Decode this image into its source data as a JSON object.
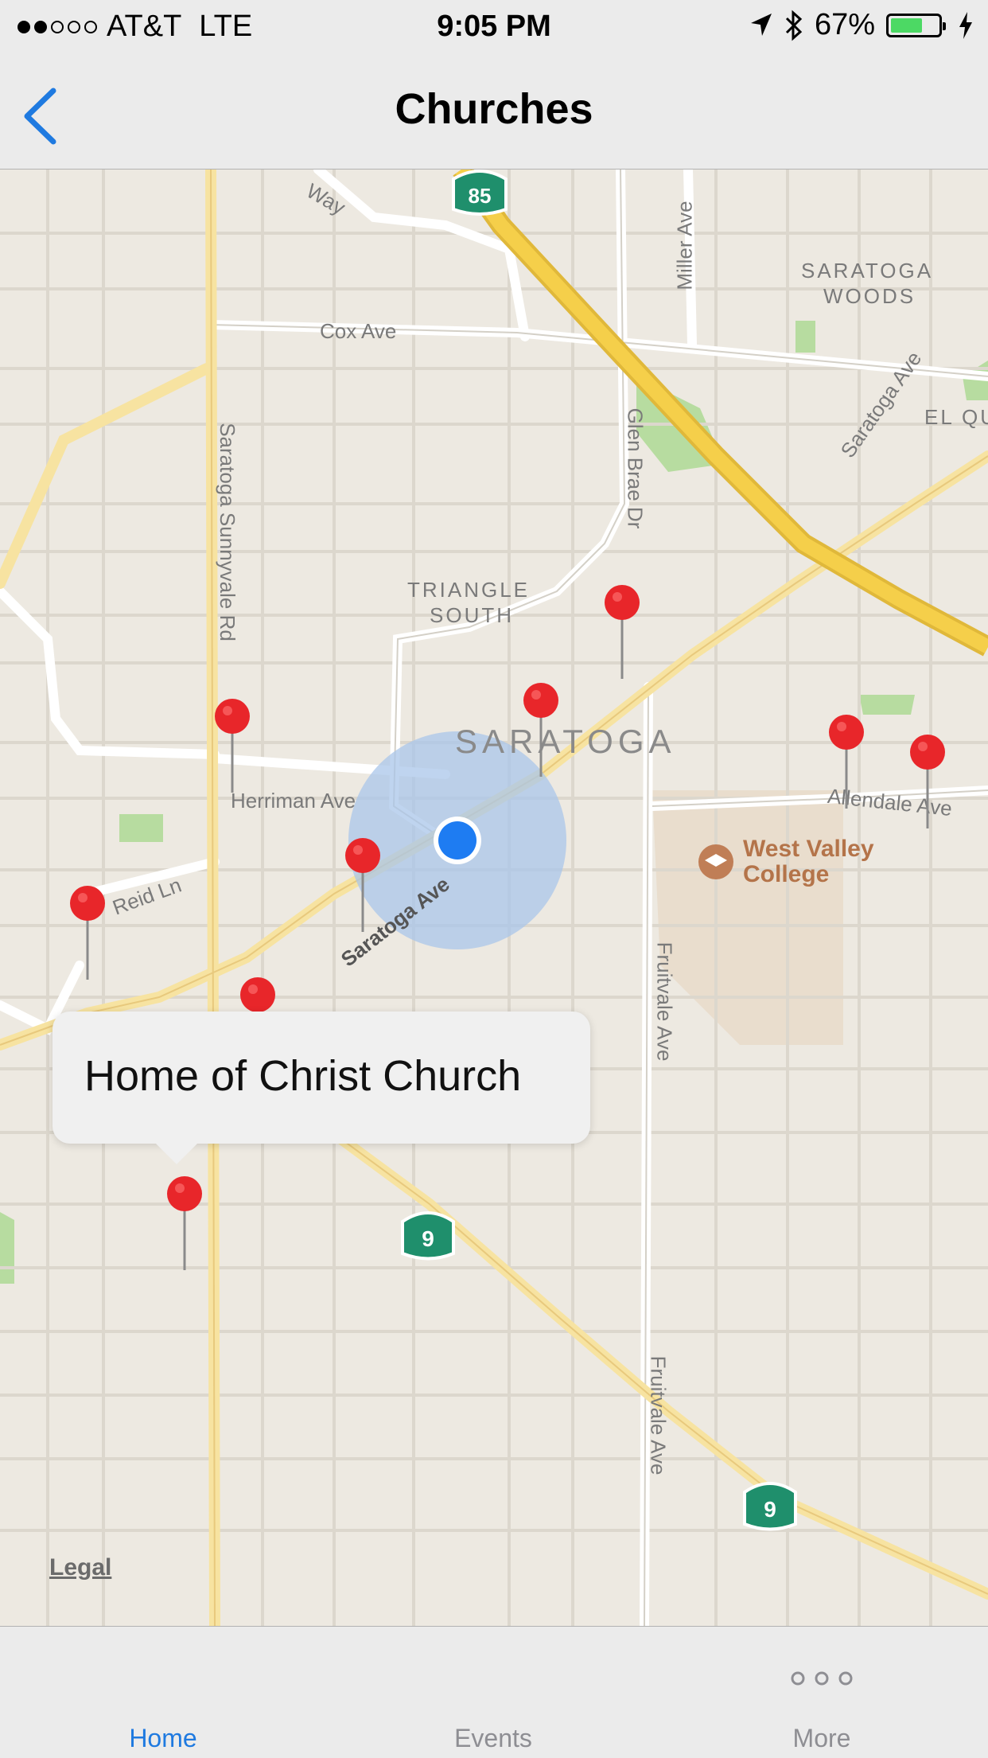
{
  "status_bar": {
    "carrier": "AT&T",
    "network": "LTE",
    "time": "9:05 PM",
    "battery_percent": "67%",
    "battery_level": 0.67,
    "signal_bars": 2,
    "icons": [
      "location-arrow-icon",
      "bluetooth-icon",
      "charging-bolt-icon"
    ]
  },
  "nav": {
    "title": "Churches",
    "back_icon": "chevron-left-icon",
    "accent_color": "#1f7ae0"
  },
  "map": {
    "city_label": "SARATOGA",
    "district_labels": [
      "TRIANGLE",
      "SOUTH",
      "SARATOGA",
      "WOODS",
      "EL QU"
    ],
    "streets": [
      "Cox Ave",
      "Miller Ave",
      "Glen Brae Dr",
      "Saratoga Ave",
      "Saratoga Sunnyvale Rd",
      "Herriman Ave",
      "Reid Ln",
      "Allendale Ave",
      "Fruitvale Ave",
      "Fruitvale Ave",
      "Saratoga Ave",
      "Way"
    ],
    "highway_shields": [
      "85",
      "9",
      "9",
      "9"
    ],
    "poi": "West Valley College",
    "poi_lines": [
      "West Valley",
      "College"
    ],
    "pin_color": "#e8262a",
    "user_location_color": "#1e7cf2",
    "callout_title": "Home of Christ Church",
    "legal_link": "Legal"
  },
  "tabs": [
    {
      "label": "Home",
      "active": true
    },
    {
      "label": "Events",
      "active": false
    },
    {
      "label": "More",
      "active": false,
      "icon": "ellipsis-icon"
    }
  ]
}
